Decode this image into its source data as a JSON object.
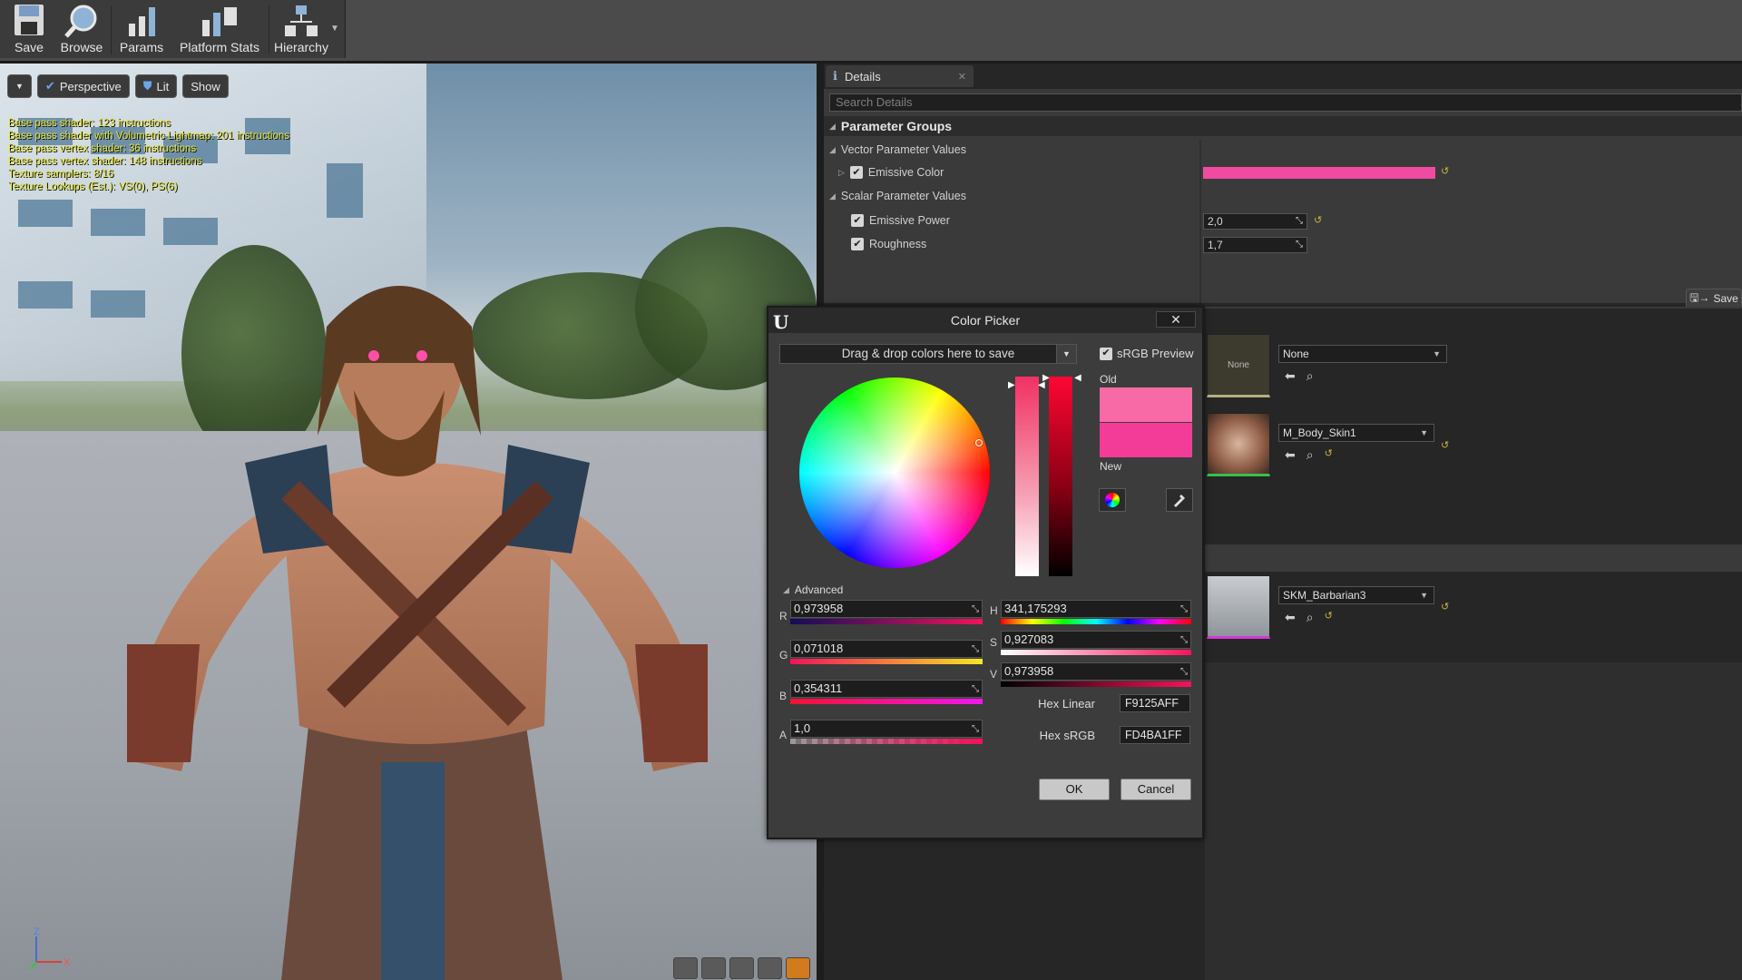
{
  "toolbar": {
    "buttons": [
      {
        "label": "Save",
        "icon": "floppy-disk-icon"
      },
      {
        "label": "Browse",
        "icon": "magnifier-icon"
      },
      {
        "label": "Params",
        "icon": "bar-params-icon"
      },
      {
        "label": "Platform Stats",
        "icon": "platform-stats-icon"
      },
      {
        "label": "Hierarchy",
        "icon": "hierarchy-icon"
      }
    ]
  },
  "viewport": {
    "perspective": "Perspective",
    "lit": "Lit",
    "show": "Show",
    "stats": [
      "Base pass shader: 123 instructions",
      "Base pass shader with Volumetric Lightmap: 201 instructions",
      "Base pass vertex shader: 36 instructions",
      "Base pass vertex shader: 148 instructions",
      "Texture samplers: 8/16",
      "Texture Lookups (Est.): VS(0), PS(6)"
    ],
    "axis_z": "Z",
    "axis_x": "X"
  },
  "details": {
    "tab": "Details",
    "search_placeholder": "Search Details",
    "group": "Parameter Groups",
    "vector_group": "Vector Parameter Values",
    "emissive_color": "Emissive Color",
    "emissive_color_hex": "#f14ba1",
    "scalar_group": "Scalar Parameter Values",
    "emissive_power_label": "Emissive Power",
    "emissive_power_value": "2,0",
    "roughness_label": "Roughness",
    "roughness_value": "1,7",
    "save": "Save"
  },
  "assets": [
    {
      "thumb": "None",
      "value": "None"
    },
    {
      "thumb": "",
      "value": "M_Body_Skin1"
    },
    {
      "thumb": "",
      "value": "SKM_Barbarian3"
    }
  ],
  "color_picker": {
    "title": "Color Picker",
    "drag_drop": "Drag & drop colors here to save",
    "srgb_preview": "sRGB Preview",
    "old_label": "Old",
    "new_label": "New",
    "old_color": "#f76aa6",
    "new_color": "#f33c98",
    "advanced": "Advanced",
    "r_label": "R",
    "r_value": "0,973958",
    "g_label": "G",
    "g_value": "0,071018",
    "b_label": "B",
    "b_value": "0,354311",
    "a_label": "A",
    "a_value": "1,0",
    "h_label": "H",
    "h_value": "341,175293",
    "s_label": "S",
    "s_value": "0,927083",
    "v_label": "V",
    "v_value": "0,973958",
    "hex_linear_label": "Hex Linear",
    "hex_linear_value": "F9125AFF",
    "hex_srgb_label": "Hex sRGB",
    "hex_srgb_value": "FD4BA1FF",
    "ok": "OK",
    "cancel": "Cancel"
  }
}
